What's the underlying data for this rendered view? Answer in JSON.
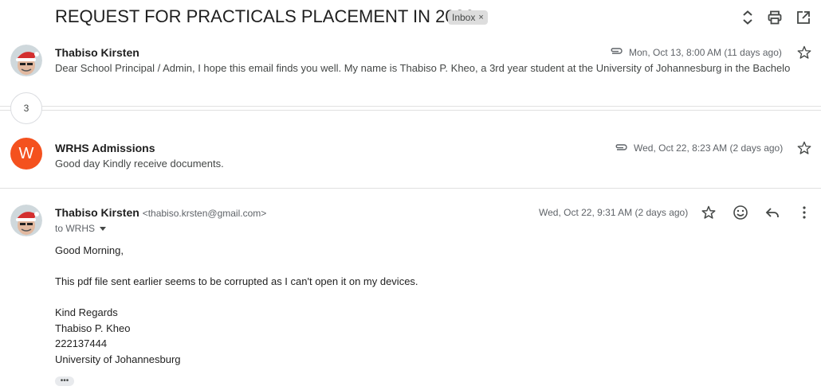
{
  "thread": {
    "subject": "REQUEST FOR PRACTICALS PLACEMENT IN 2026",
    "label_chip": "Inbox",
    "label_remove": "×",
    "collapsed_count": "3"
  },
  "messages": [
    {
      "sender": "Thabiso Kirsten",
      "date": "Mon, Oct 13, 8:00 AM (11 days ago)",
      "snippet": "Dear School Principal / Admin, I hope this email finds you well. My name is Thabiso P. Kheo, a 3rd year student at the University of Johannesburg in the Bachelo",
      "has_attachment": true,
      "avatar": "santa-hat-avatar"
    },
    {
      "sender": "WRHS Admissions",
      "avatar_letter": "W",
      "date": "Wed, Oct 22, 8:23 AM (2 days ago)",
      "snippet": "Good day Kindly receive documents.",
      "has_attachment": true,
      "avatar_color": "#f4511e"
    },
    {
      "sender": "Thabiso Kirsten",
      "email": "<thabiso.krsten@gmail.com>",
      "to": "to WRHS",
      "date": "Wed, Oct 22, 9:31 AM (2 days ago)",
      "body": [
        "Good Morning,",
        "This pdf file sent earlier seems to be corrupted as I can't open it on my devices.",
        "Kind Regards",
        "Thabiso P. Kheo",
        "222137444",
        "University of Johannesburg"
      ],
      "more": "•••",
      "avatar": "santa-hat-avatar"
    }
  ],
  "icons": {
    "expand": "unfold-icon",
    "print": "print-icon",
    "open_new": "open-in-new-icon",
    "star": "star-outline-icon",
    "emoji": "emoji-reaction-icon",
    "reply": "reply-icon",
    "more": "more-vert-icon",
    "attachment": "paperclip-icon"
  },
  "colors": {
    "accent_avatar": "#f4511e",
    "chip_bg": "#dddddd"
  }
}
